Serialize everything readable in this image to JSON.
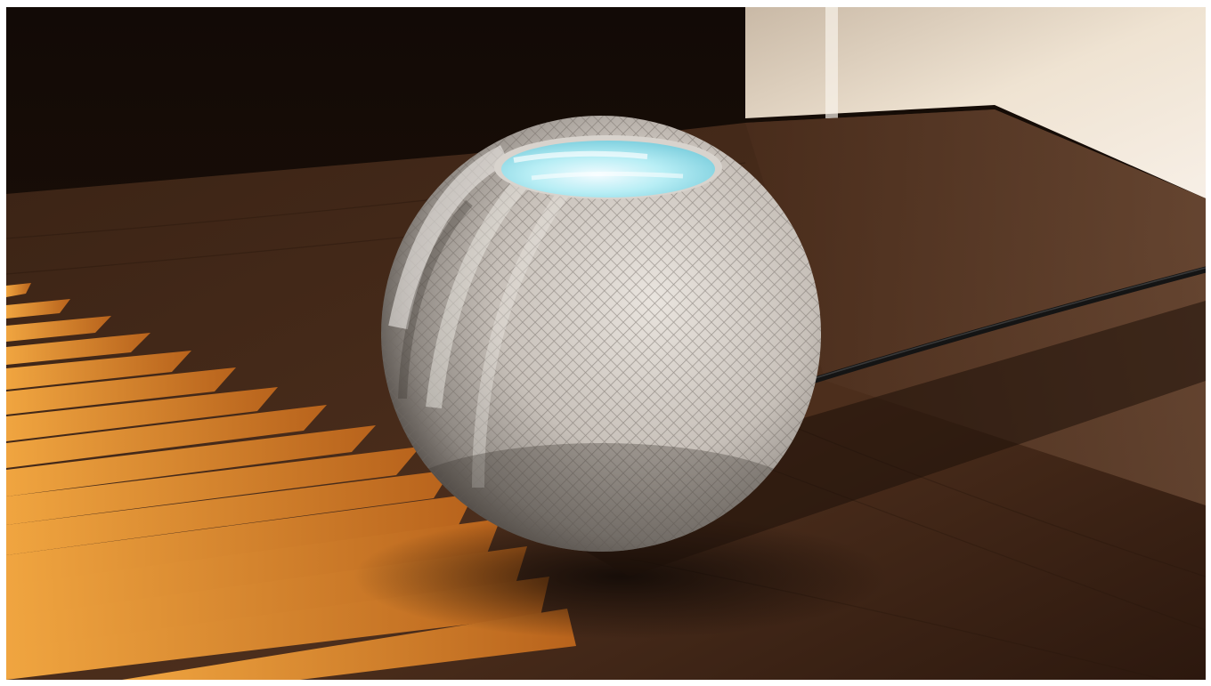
{
  "image": {
    "subject": "smart-speaker-on-wooden-table",
    "colors": {
      "wall_dark": "#1b100a",
      "table_wood": "#4a2c1a",
      "sunlight_stripe": "#e0902e",
      "window_glow": "#f1e5d4",
      "speaker_mesh": "#cfc8c2",
      "speaker_top_light": "#9fe6f0",
      "cable": "#141414"
    }
  }
}
